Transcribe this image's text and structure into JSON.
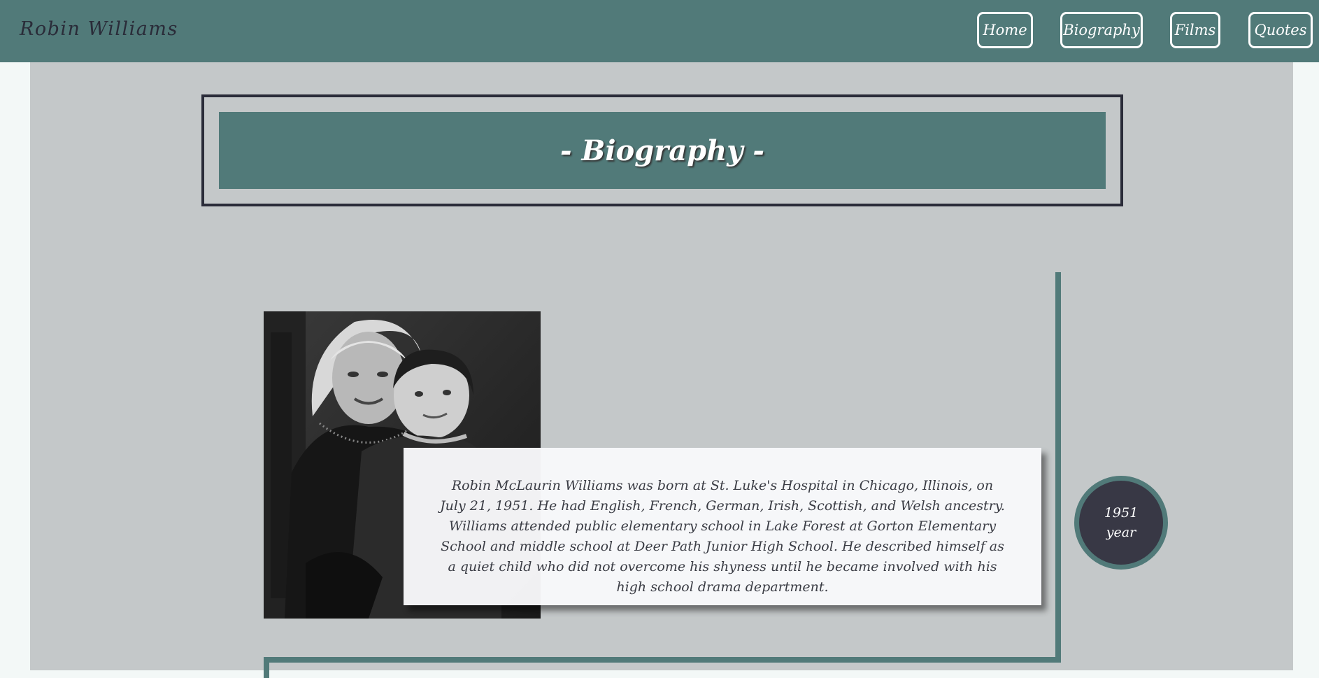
{
  "header": {
    "brand": "Robin Williams",
    "nav": [
      {
        "label": "Home"
      },
      {
        "label": "Biography"
      },
      {
        "label": "Films"
      },
      {
        "label": "Quotes"
      }
    ]
  },
  "main": {
    "title": "- Biography -",
    "entries": [
      {
        "photo_icon": "mother-and-child-photo",
        "text": "Robin McLaurin Williams was born at St. Luke's Hospital in Chicago, Illinois, on July 21, 1951. He had English, French, German, Irish, Scottish, and Welsh ancestry. Williams attended public elementary school in Lake Forest at Gorton Elementary School and middle school at Deer Path Junior High School. He described himself as a quiet child who did not overcome his shyness until he became involved with his high school drama department.",
        "year": "1951",
        "year_label": "year"
      }
    ]
  },
  "colors": {
    "header_bg": "#517a79",
    "content_bg": "#c4c8c9",
    "dark": "#2a2c39",
    "badge": "#383845"
  }
}
